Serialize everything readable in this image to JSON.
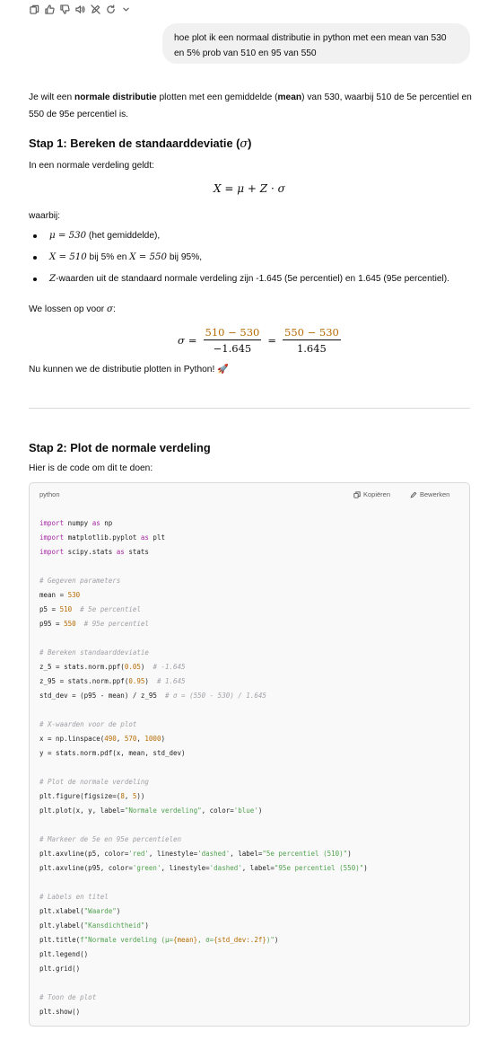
{
  "toolbar": {
    "icons": [
      "copy-icon",
      "thumbs-up-icon",
      "thumbs-down-icon",
      "speaker-icon",
      "edit-off-icon",
      "regenerate-icon",
      "chevron-down-icon"
    ]
  },
  "user_message": "hoe plot ik een normaal distributie in python met een mean van 530 en 5% prob van 510 en 95 van 550",
  "intro": {
    "t1": "Je wilt een ",
    "b1": "normale distributie",
    "t2": " plotten met een gemiddelde (",
    "b2": "mean",
    "t3": ") van 530, waarbij 510 de 5e percentiel en 550 de 95e percentiel is."
  },
  "step1": {
    "title": "Stap 1: Bereken de standaarddeviatie (",
    "title_symbol": "σ",
    "title_end": ")",
    "lead": "In een normale verdeling geldt:",
    "formula": {
      "lhs": "X",
      "eq": "=",
      "mu": "μ",
      "plus": "+",
      "z": "Z",
      "dot": "·",
      "sigma": "σ"
    },
    "waarbij": "waarbij:",
    "bullets": {
      "b1_math": "μ = 530",
      "b1_text": " (het gemiddelde),",
      "b2_math1": "X = 510",
      "b2_text1": " bij 5% en ",
      "b2_math2": "X = 550",
      "b2_text2": " bij 95%,",
      "b3_math": "Z",
      "b3_text1": "-waarden uit de standaard normale verdeling zijn ",
      "b3_bold1": "-1.645",
      "b3_text2": " (5e percentiel) en ",
      "b3_bold2": "1.645",
      "b3_text3": " (95e percentiel)."
    },
    "solve_lead": "We lossen op voor ",
    "solve_symbol": "σ",
    "solve_colon": ":",
    "equation": {
      "lhs": "σ",
      "eq": "=",
      "num1": "510 − 530",
      "den1": "−1.645",
      "op": "=",
      "num2": "550 − 530",
      "den2": "1.645"
    },
    "outro": "Nu kunnen we de distributie plotten in Python! 🚀"
  },
  "step2": {
    "title": "Stap 2: Plot de normale verdeling",
    "lead": "Hier is de code om dit te doen:"
  },
  "code_block": {
    "language": "python",
    "copy_label": "Kopiëren",
    "edit_label": "Bewerken",
    "lines": [
      {
        "tokens": [
          {
            "t": "import",
            "c": "kw"
          },
          {
            "t": " numpy ",
            "c": ""
          },
          {
            "t": "as",
            "c": "kw"
          },
          {
            "t": " np",
            "c": ""
          }
        ]
      },
      {
        "tokens": [
          {
            "t": "import",
            "c": "kw"
          },
          {
            "t": " matplotlib.pyplot ",
            "c": ""
          },
          {
            "t": "as",
            "c": "kw"
          },
          {
            "t": " plt",
            "c": ""
          }
        ]
      },
      {
        "tokens": [
          {
            "t": "import",
            "c": "kw"
          },
          {
            "t": " scipy.stats ",
            "c": ""
          },
          {
            "t": "as",
            "c": "kw"
          },
          {
            "t": " stats",
            "c": ""
          }
        ]
      },
      {
        "tokens": []
      },
      {
        "tokens": [
          {
            "t": "# Gegeven parameters",
            "c": "cm"
          }
        ]
      },
      {
        "tokens": [
          {
            "t": "mean = ",
            "c": ""
          },
          {
            "t": "530",
            "c": "num"
          }
        ]
      },
      {
        "tokens": [
          {
            "t": "p5 = ",
            "c": ""
          },
          {
            "t": "510",
            "c": "num"
          },
          {
            "t": "  ",
            "c": ""
          },
          {
            "t": "# 5e percentiel",
            "c": "cm"
          }
        ]
      },
      {
        "tokens": [
          {
            "t": "p95 = ",
            "c": ""
          },
          {
            "t": "550",
            "c": "num"
          },
          {
            "t": "  ",
            "c": ""
          },
          {
            "t": "# 95e percentiel",
            "c": "cm"
          }
        ]
      },
      {
        "tokens": []
      },
      {
        "tokens": [
          {
            "t": "# Bereken standaarddeviatie",
            "c": "cm"
          }
        ]
      },
      {
        "tokens": [
          {
            "t": "z_5 = stats.norm.ppf(",
            "c": ""
          },
          {
            "t": "0.05",
            "c": "num"
          },
          {
            "t": ")  ",
            "c": ""
          },
          {
            "t": "# -1.645",
            "c": "cm"
          }
        ]
      },
      {
        "tokens": [
          {
            "t": "z_95 = stats.norm.ppf(",
            "c": ""
          },
          {
            "t": "0.95",
            "c": "num"
          },
          {
            "t": ")  ",
            "c": ""
          },
          {
            "t": "# 1.645",
            "c": "cm"
          }
        ]
      },
      {
        "tokens": [
          {
            "t": "std_dev = (p95 - mean) / z_95  ",
            "c": ""
          },
          {
            "t": "# σ = (550 - 530) / 1.645",
            "c": "cm"
          }
        ]
      },
      {
        "tokens": []
      },
      {
        "tokens": [
          {
            "t": "# X-waarden voor de plot",
            "c": "cm"
          }
        ]
      },
      {
        "tokens": [
          {
            "t": "x = np.linspace(",
            "c": ""
          },
          {
            "t": "490",
            "c": "num"
          },
          {
            "t": ", ",
            "c": ""
          },
          {
            "t": "570",
            "c": "num"
          },
          {
            "t": ", ",
            "c": ""
          },
          {
            "t": "1000",
            "c": "num"
          },
          {
            "t": ")",
            "c": ""
          }
        ]
      },
      {
        "tokens": [
          {
            "t": "y = stats.norm.pdf(x, mean, std_dev)",
            "c": ""
          }
        ]
      },
      {
        "tokens": []
      },
      {
        "tokens": [
          {
            "t": "# Plot de normale verdeling",
            "c": "cm"
          }
        ]
      },
      {
        "tokens": [
          {
            "t": "plt.figure(figsize=(",
            "c": ""
          },
          {
            "t": "8",
            "c": "num"
          },
          {
            "t": ", ",
            "c": ""
          },
          {
            "t": "5",
            "c": "num"
          },
          {
            "t": "))",
            "c": ""
          }
        ]
      },
      {
        "tokens": [
          {
            "t": "plt.plot(x, y, label=",
            "c": ""
          },
          {
            "t": "\"Normale verdeling\"",
            "c": "str"
          },
          {
            "t": ", color=",
            "c": ""
          },
          {
            "t": "'blue'",
            "c": "str"
          },
          {
            "t": ")",
            "c": ""
          }
        ]
      },
      {
        "tokens": []
      },
      {
        "tokens": [
          {
            "t": "# Markeer de 5e en 95e percentielen",
            "c": "cm"
          }
        ]
      },
      {
        "tokens": [
          {
            "t": "plt.axvline(p5, color=",
            "c": ""
          },
          {
            "t": "'red'",
            "c": "str"
          },
          {
            "t": ", linestyle=",
            "c": ""
          },
          {
            "t": "'dashed'",
            "c": "str"
          },
          {
            "t": ", label=",
            "c": ""
          },
          {
            "t": "\"5e percentiel (510)\"",
            "c": "str"
          },
          {
            "t": ")",
            "c": ""
          }
        ]
      },
      {
        "tokens": [
          {
            "t": "plt.axvline(p95, color=",
            "c": ""
          },
          {
            "t": "'green'",
            "c": "str"
          },
          {
            "t": ", linestyle=",
            "c": ""
          },
          {
            "t": "'dashed'",
            "c": "str"
          },
          {
            "t": ", label=",
            "c": ""
          },
          {
            "t": "\"95e percentiel (550)\"",
            "c": "str"
          },
          {
            "t": ")",
            "c": ""
          }
        ]
      },
      {
        "tokens": []
      },
      {
        "tokens": [
          {
            "t": "# Labels en titel",
            "c": "cm"
          }
        ]
      },
      {
        "tokens": [
          {
            "t": "plt.xlabel(",
            "c": ""
          },
          {
            "t": "\"Waarde\"",
            "c": "str"
          },
          {
            "t": ")",
            "c": ""
          }
        ]
      },
      {
        "tokens": [
          {
            "t": "plt.ylabel(",
            "c": ""
          },
          {
            "t": "\"Kansdichtheid\"",
            "c": "str"
          },
          {
            "t": ")",
            "c": ""
          }
        ]
      },
      {
        "tokens": [
          {
            "t": "plt.title(",
            "c": ""
          },
          {
            "t": "f\"Normale verdeling (μ=",
            "c": "str"
          },
          {
            "t": "{mean}",
            "c": "num"
          },
          {
            "t": ", σ=",
            "c": "str"
          },
          {
            "t": "{std_dev:.2f}",
            "c": "num"
          },
          {
            "t": ")\"",
            "c": "str"
          },
          {
            "t": ")",
            "c": ""
          }
        ]
      },
      {
        "tokens": [
          {
            "t": "plt.legend()",
            "c": ""
          }
        ]
      },
      {
        "tokens": [
          {
            "t": "plt.grid()",
            "c": ""
          }
        ]
      },
      {
        "tokens": []
      },
      {
        "tokens": [
          {
            "t": "# Toon de plot",
            "c": "cm"
          }
        ]
      },
      {
        "tokens": [
          {
            "t": "plt.show()",
            "c": ""
          }
        ]
      }
    ]
  }
}
